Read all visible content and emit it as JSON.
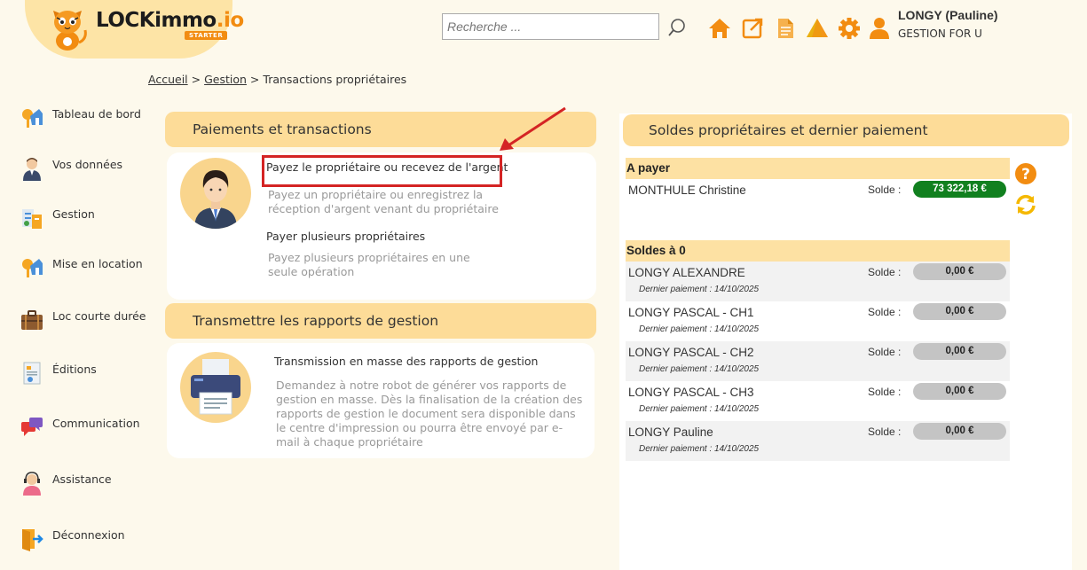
{
  "brand": {
    "name_main": "LOCKimmo",
    "name_suffix": ".io",
    "edition": "STARTER"
  },
  "search": {
    "placeholder": "Recherche ..."
  },
  "header_icons": [
    "search-icon",
    "home-icon",
    "external-link-icon",
    "document-icon",
    "drive-icon",
    "gear-icon",
    "user-icon"
  ],
  "user": {
    "name": "LONGY (Pauline)",
    "organization": "GESTION FOR U"
  },
  "breadcrumb": {
    "home": "Accueil",
    "sep1": ">",
    "section": "Gestion",
    "sep2": ">",
    "current": "Transactions propriétaires"
  },
  "sidebar": {
    "items": [
      {
        "label": "Tableau de bord",
        "icon": "dashboard-icon"
      },
      {
        "label": "Vos données",
        "icon": "person-icon"
      },
      {
        "label": "Gestion",
        "icon": "management-icon"
      },
      {
        "label": "Mise en location",
        "icon": "rent-key-icon"
      },
      {
        "label": "Loc courte durée",
        "icon": "suitcase-icon"
      },
      {
        "label": "Éditions",
        "icon": "report-icon"
      },
      {
        "label": "Communication",
        "icon": "chat-icon"
      },
      {
        "label": "Assistance",
        "icon": "support-icon"
      },
      {
        "label": "Déconnexion",
        "icon": "logout-icon"
      }
    ]
  },
  "payments": {
    "title": "Paiements et transactions",
    "items": [
      {
        "title": "Payez le propriétaire ou recevez de l'argent",
        "desc_line1": "Payez un propriétaire ou enregistrez la",
        "desc_line2": "réception d'argent venant du propriétaire"
      },
      {
        "title": "Payer plusieurs propriétaires",
        "desc_line1": "Payez plusieurs propriétaires en une",
        "desc_line2": "seule opération"
      }
    ]
  },
  "reports": {
    "title": "Transmettre les rapports de gestion",
    "item": {
      "title": "Transmission en masse des rapports de gestion",
      "desc_lines": [
        "Demandez à notre robot de générer vos rapports de",
        "gestion en masse. Dès la finalisation de la création des",
        "rapports de gestion le document sera disponible dans",
        "le centre d'impression ou pourra être envoyé par e-",
        "mail à chaque propriétaire"
      ]
    }
  },
  "balances": {
    "title": "Soldes propriétaires et dernier paiement",
    "to_pay_header": "A payer",
    "to_pay": [
      {
        "name": "MONTHULE Christine",
        "solde_label": "Solde :",
        "amount": "73 322,18 €"
      }
    ],
    "zero_header": "Soldes à 0",
    "zero": [
      {
        "name": "LONGY ALEXANDRE",
        "solde_label": "Solde :",
        "amount": "0,00 €",
        "last_payment": "Dernier paiement : 14/10/2025"
      },
      {
        "name": "LONGY PASCAL - CH1",
        "solde_label": "Solde :",
        "amount": "0,00 €",
        "last_payment": "Dernier paiement : 14/10/2025"
      },
      {
        "name": "LONGY PASCAL - CH2",
        "solde_label": "Solde :",
        "amount": "0,00 €",
        "last_payment": "Dernier paiement : 14/10/2025"
      },
      {
        "name": "LONGY PASCAL - CH3",
        "solde_label": "Solde :",
        "amount": "0,00 €",
        "last_payment": "Dernier paiement : 14/10/2025"
      },
      {
        "name": "LONGY Pauline",
        "solde_label": "Solde :",
        "amount": "0,00 €",
        "last_payment": "Dernier paiement : 14/10/2025"
      }
    ]
  },
  "colors": {
    "accent": "#f28c11",
    "panel_header": "#fddc98",
    "positive_balance": "#11801f",
    "highlight": "#d42424"
  }
}
